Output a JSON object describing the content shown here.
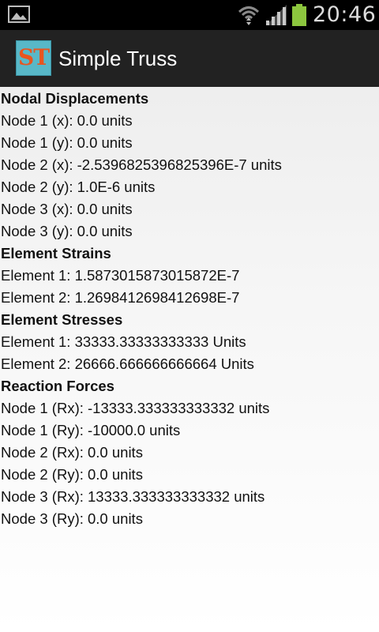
{
  "status_bar": {
    "time": "20:46",
    "icons": {
      "notification": "gallery-icon",
      "wifi": "wifi-icon",
      "signal": "cell-signal-icon",
      "battery": "battery-icon"
    },
    "battery_color": "#8cc63e"
  },
  "action_bar": {
    "logo_text": "ST",
    "title": "Simple Truss",
    "logo_bg": "#58b8c8",
    "logo_fg": "#e8551f"
  },
  "sections": {
    "nodal_displacements": {
      "heading": "Nodal Displacements",
      "items": [
        "Node 1 (x): 0.0 units",
        "Node 1 (y): 0.0 units",
        "Node 2 (x): -2.5396825396825396E-7 units",
        "Node 2 (y): 1.0E-6 units",
        "Node 3 (x): 0.0 units",
        "Node 3 (y): 0.0 units"
      ]
    },
    "element_strains": {
      "heading": "Element Strains",
      "items": [
        "Element 1: 1.5873015873015872E-7",
        "Element 2: 1.2698412698412698E-7"
      ]
    },
    "element_stresses": {
      "heading": "Element Stresses",
      "items": [
        "Element 1: 33333.33333333333 Units",
        "Element 2: 26666.666666666664 Units"
      ]
    },
    "reaction_forces": {
      "heading": "Reaction Forces",
      "items": [
        "Node 1 (Rx): -13333.333333333332 units",
        "Node 1 (Ry): -10000.0 units",
        "Node 2 (Rx): 0.0 units",
        "Node 2 (Ry): 0.0 units",
        "Node 3 (Rx): 13333.333333333332 units",
        "Node 3 (Ry): 0.0 units"
      ]
    }
  }
}
